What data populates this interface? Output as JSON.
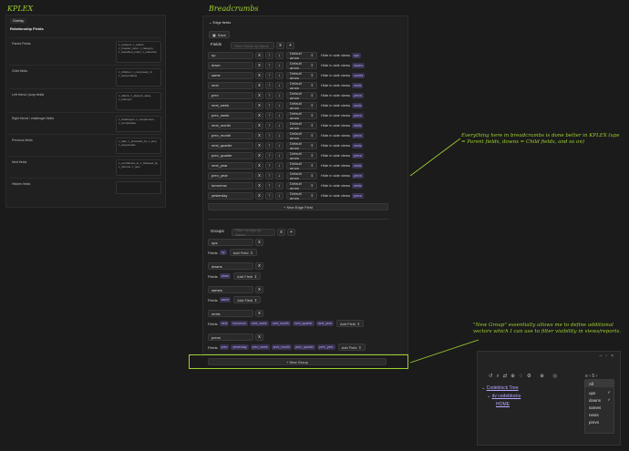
{
  "kplex": {
    "title": "KPLEX",
    "overlay_label": "Overlay",
    "section": "Relationship Fields",
    "rows": [
      {
        "label": "Parent Fields",
        "value": "z_answers, z_author, z_broader_topic, z_category, z_classified_under, z_collection"
      },
      {
        "label": "Child fields",
        "value": "z_children, z_composed_of, z_descendants"
      },
      {
        "label": "Left friend / jump fields",
        "value": "z_affects, z_aligned_value, z_antonym"
      },
      {
        "label": "Right friend / challenger fields",
        "value": "z_challenges, z_complement, z_complicates"
      },
      {
        "label": "Previous fields",
        "value": "z_date, z_preceded_by, z_prev, z_supersedes"
      },
      {
        "label": "Next fields",
        "value": "z_contributed_to, z_followed_by, z_informs, z_next"
      },
      {
        "label": "Hidden fields",
        "value": ""
      }
    ]
  },
  "breadcrumbs": {
    "title": "Breadcrumbs",
    "section": "Edge fields",
    "save_label": "Save",
    "fields_label": "Fields",
    "filter_fields_placeholder": "Filter Fields by Name",
    "side_label": "Hide in side views",
    "edge_fields": [
      {
        "name": "up",
        "arrow": "Default arrow",
        "tag": "ups"
      },
      {
        "name": "down",
        "arrow": "Default arrow",
        "tag": "downs"
      },
      {
        "name": "same",
        "arrow": "Default arrow",
        "tag": "sames"
      },
      {
        "name": "next",
        "arrow": "Default arrow",
        "tag": "nexts"
      },
      {
        "name": "prev",
        "arrow": "Default arrow",
        "tag": "prevs"
      },
      {
        "name": "next_week",
        "arrow": "Default arrow",
        "tag": "nexts"
      },
      {
        "name": "prev_week",
        "arrow": "Default arrow",
        "tag": "prevs"
      },
      {
        "name": "next_month",
        "arrow": "Default arrow",
        "tag": "nexts"
      },
      {
        "name": "prev_month",
        "arrow": "Default arrow",
        "tag": "prevs"
      },
      {
        "name": "next_quarter",
        "arrow": "Default arrow",
        "tag": "nexts"
      },
      {
        "name": "prev_quarter",
        "arrow": "Default arrow",
        "tag": "prevs"
      },
      {
        "name": "next_year",
        "arrow": "Default arrow",
        "tag": "nexts"
      },
      {
        "name": "prev_year",
        "arrow": "Default arrow",
        "tag": "prevs"
      },
      {
        "name": "tomorrow",
        "arrow": "Default arrow",
        "tag": "nexts"
      },
      {
        "name": "yesterday",
        "arrow": "Default arrow",
        "tag": "prevs"
      }
    ],
    "new_edge_field": "+ New Edge Field",
    "groups_label": "Groups",
    "filter_groups_placeholder": "Filter Groups by Name",
    "add_field": "Add Field",
    "fields_word": "Fields",
    "groups": [
      {
        "name": "ups",
        "tags": [
          "up"
        ]
      },
      {
        "name": "downs",
        "tags": [
          "down"
        ]
      },
      {
        "name": "sames",
        "tags": [
          "same"
        ]
      },
      {
        "name": "nexts",
        "tags": [
          "next",
          "tomorrow",
          "next_week",
          "next_month",
          "next_quarter",
          "next_year"
        ]
      },
      {
        "name": "prevs",
        "tags": [
          "prev",
          "yesterday",
          "prev_week",
          "prev_month",
          "prev_quarter",
          "prev_year"
        ]
      }
    ],
    "new_group": "+ New Group"
  },
  "annotations": {
    "note1": "Everything here in breadcrumbs is done better in KPLEX (ups = Parent fields, downs = Child fields, and so on)",
    "note2": "\"New Group\" essentially allows me to define additional vectors which I can use to filter visibility in views/reports."
  },
  "sidepanel": {
    "tree_root": "Codeblock Tree",
    "tree_child": "dv codeblocks",
    "tree_leaf": "HOME",
    "depth_label": "5",
    "menu": [
      {
        "label": "All",
        "checked": false
      },
      {
        "label": "ups",
        "checked": true
      },
      {
        "label": "downs",
        "checked": true
      },
      {
        "label": "sames",
        "checked": false
      },
      {
        "label": "nexts",
        "checked": false
      },
      {
        "label": "prevs",
        "checked": false
      }
    ]
  },
  "colors": {
    "accent": "#9fd12e",
    "tag": "#b9a7ff"
  }
}
